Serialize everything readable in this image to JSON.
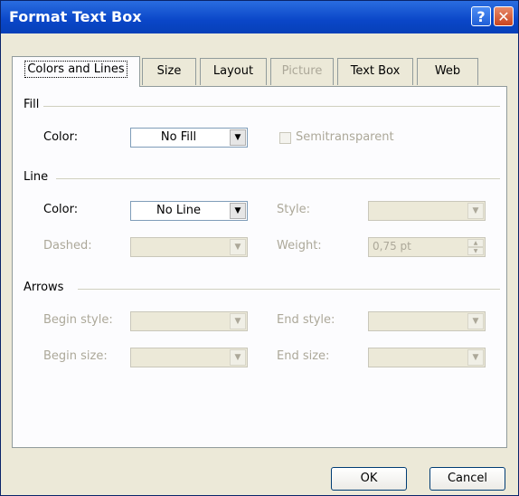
{
  "window": {
    "title": "Format Text Box",
    "help_glyph": "?",
    "close_glyph": "✕"
  },
  "tabs": [
    {
      "label": "Colors and Lines",
      "active": true,
      "enabled": true
    },
    {
      "label": "Size",
      "enabled": true
    },
    {
      "label": "Layout",
      "enabled": true
    },
    {
      "label": "Picture",
      "enabled": false
    },
    {
      "label": "Text Box",
      "enabled": true
    },
    {
      "label": "Web",
      "enabled": true
    }
  ],
  "fill": {
    "section_label": "Fill",
    "color_label": "Color:",
    "color_value": "No Fill",
    "semitransparent_label": "Semitransparent",
    "semitransparent_checked": false
  },
  "line": {
    "section_label": "Line",
    "color_label": "Color:",
    "color_value": "No Line",
    "style_label": "Style:",
    "dashed_label": "Dashed:",
    "weight_label": "Weight:",
    "weight_value": "0,75 pt"
  },
  "arrows": {
    "section_label": "Arrows",
    "begin_style_label": "Begin style:",
    "end_style_label": "End style:",
    "begin_size_label": "Begin size:",
    "end_size_label": "End size:"
  },
  "buttons": {
    "ok": "OK",
    "cancel": "Cancel"
  },
  "icons": {
    "dropdown": "▼",
    "spin_up": "▲",
    "spin_down": "▼"
  },
  "colors": {
    "titlebar": "#0a46c8",
    "dialog_bg": "#ece9d8",
    "panel_bg": "#fcfcfe",
    "disabled_text": "#aca899"
  }
}
